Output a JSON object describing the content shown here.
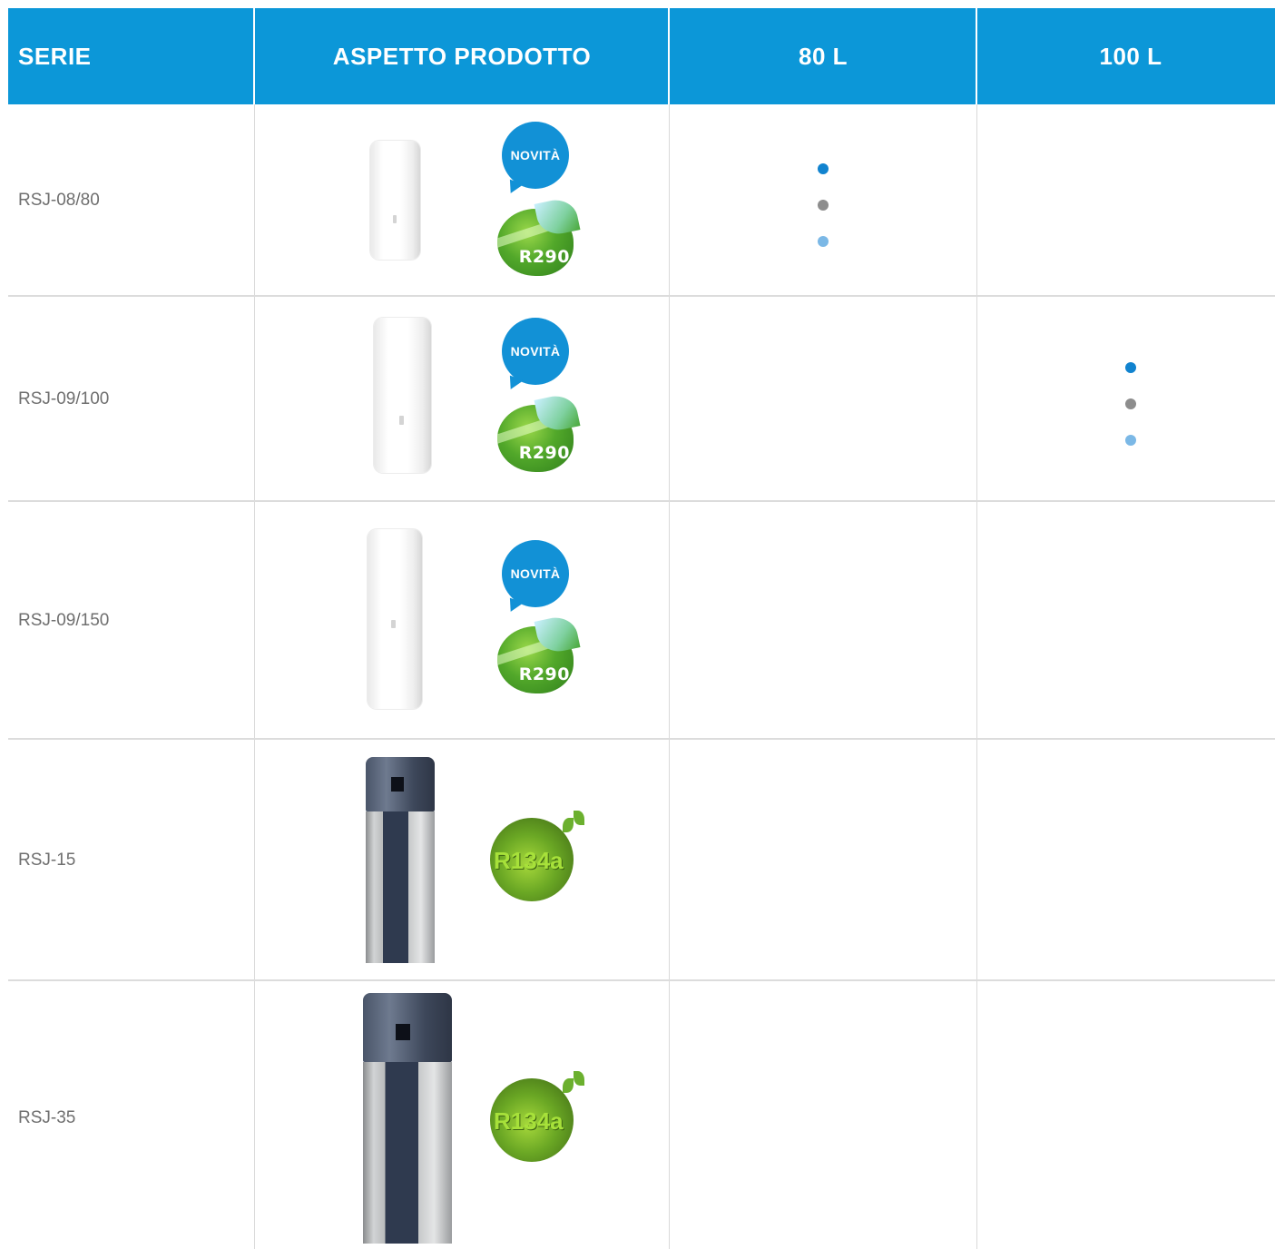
{
  "header": {
    "serie": "SERIE",
    "aspetto": "ASPETTO PRODOTTO",
    "col_80": "80 L",
    "col_100": "100 L"
  },
  "colors": {
    "header_bg": "#0c97d8",
    "dot_primary": "#1183cf",
    "dot_gray": "#8d8d8d",
    "dot_light": "#7bb8e6"
  },
  "rows": [
    {
      "serie": "RSJ-08/80",
      "product": "white-tank-icon",
      "badges": {
        "novita": "NOVITÀ",
        "refrigerant": "R290"
      },
      "availability": {
        "80 L": [
          "blue",
          "gray",
          "light-blue"
        ],
        "100 L": []
      }
    },
    {
      "serie": "RSJ-09/100",
      "product": "white-tank-icon",
      "badges": {
        "novita": "NOVITÀ",
        "refrigerant": "R290"
      },
      "availability": {
        "80 L": [],
        "100 L": [
          "blue",
          "gray",
          "light-blue"
        ]
      }
    },
    {
      "serie": "RSJ-09/150",
      "product": "white-tank-icon",
      "badges": {
        "novita": "NOVITÀ",
        "refrigerant": "R290"
      },
      "availability": {
        "80 L": [],
        "100 L": []
      }
    },
    {
      "serie": "RSJ-15",
      "product": "steel-tank-icon",
      "badges": {
        "refrigerant": "R134a"
      },
      "availability": {
        "80 L": [],
        "100 L": []
      }
    },
    {
      "serie": "RSJ-35",
      "product": "steel-tank-icon",
      "badges": {
        "refrigerant": "R134a"
      },
      "availability": {
        "80 L": [],
        "100 L": []
      }
    }
  ]
}
